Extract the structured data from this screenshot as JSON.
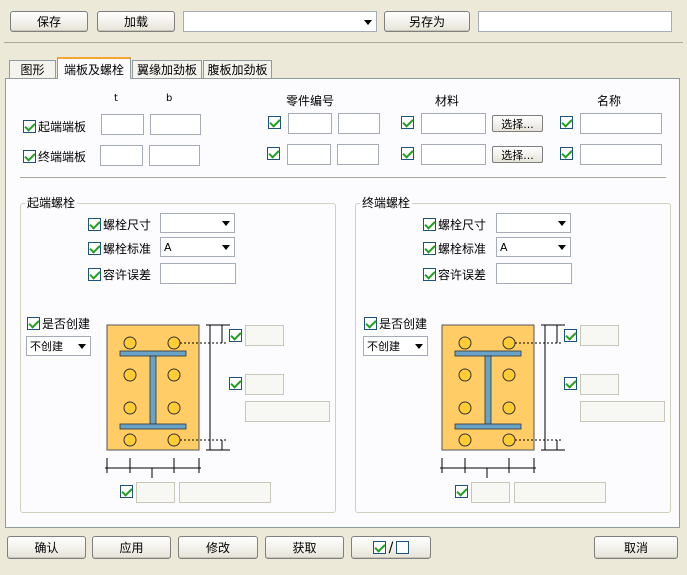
{
  "toolbar": {
    "save": "保存",
    "load": "加载",
    "save_as": "另存为",
    "preset_value": "",
    "save_as_name": ""
  },
  "tabs": [
    {
      "label": "图形"
    },
    {
      "label": "端板及螺栓"
    },
    {
      "label": "翼缘加劲板"
    },
    {
      "label": "腹板加劲板"
    }
  ],
  "plates": {
    "col_t": "t",
    "col_b": "b",
    "col_part_no": "零件编号",
    "col_material": "材料",
    "col_name": "名称",
    "start_plate": "起端端板",
    "end_plate": "终端端板",
    "select": "选择..."
  },
  "start_bolts": {
    "title": "起端螺栓",
    "bolt_size": "螺栓尺寸",
    "bolt_standard": "螺栓标准",
    "standard_value": "A",
    "tolerance": "容许误差",
    "create": "是否创建",
    "create_value": "不创建"
  },
  "end_bolts": {
    "title": "终端螺栓",
    "bolt_size": "螺栓尺寸",
    "bolt_standard": "螺栓标准",
    "standard_value": "A",
    "tolerance": "容许误差",
    "create": "是否创建",
    "create_value": "不创建"
  },
  "footer": {
    "ok": "确认",
    "apply": "应用",
    "modify": "修改",
    "get": "获取",
    "toggle": "/",
    "cancel": "取消"
  },
  "colors": {
    "plate": "#ffcc66",
    "beam": "#6aa3c8",
    "bolt": "#ffcc33",
    "accent": "#f5a530"
  }
}
